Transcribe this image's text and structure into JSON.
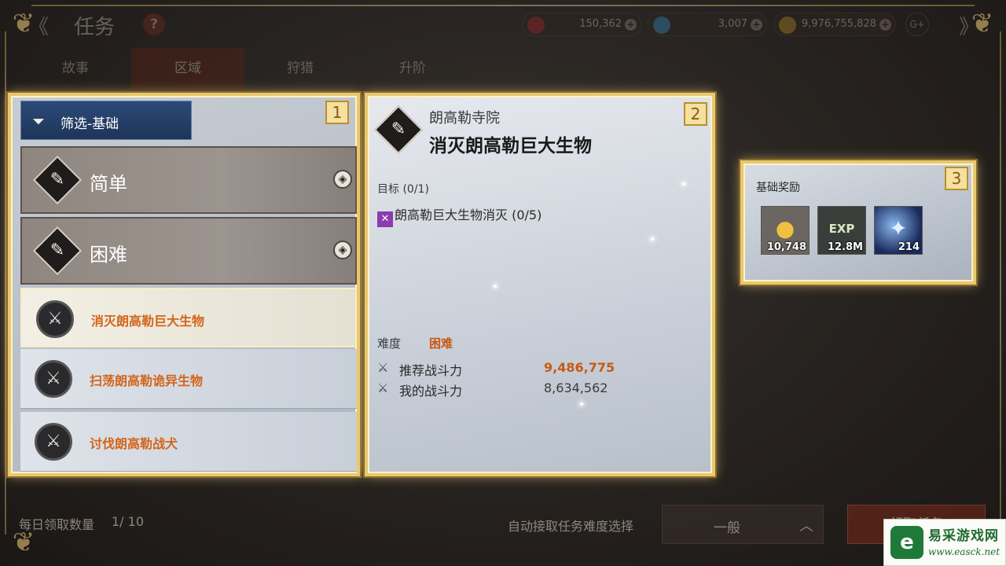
{
  "header": {
    "back_glyph": "《",
    "title": "任务",
    "help_glyph": "?",
    "currencies": [
      {
        "name": "red-gem",
        "value": "150,362",
        "color": "#c03030"
      },
      {
        "name": "blue-crystal",
        "value": "3,007",
        "color": "#3fa0d8"
      },
      {
        "name": "gold-coin",
        "value": "9,976,755,828",
        "color": "#d4a030"
      }
    ],
    "plus_glyph": "+",
    "extra_badge": "G+",
    "next_glyph": "》"
  },
  "tabs": [
    {
      "label": "故事",
      "active": false
    },
    {
      "label": "区域",
      "active": true
    },
    {
      "label": "狩猎",
      "active": false
    },
    {
      "label": "升阶",
      "active": false
    }
  ],
  "panel1": {
    "badge": "1",
    "filter_label": "筛选-基础",
    "categories": [
      {
        "label": "简单",
        "chevron": "◈"
      },
      {
        "label": "困难",
        "chevron": "◈"
      }
    ],
    "quests": [
      {
        "label": "消灭朗高勒巨大生物",
        "selected": true
      },
      {
        "label": "扫荡朗高勒诡异生物",
        "selected": false
      },
      {
        "label": "讨伐朗高勒战犬",
        "selected": false
      }
    ]
  },
  "panel2": {
    "badge": "2",
    "region": "朗高勒寺院",
    "title": "消灭朗高勒巨大生物",
    "goal_label": "目标 (0/1)",
    "goal_item": "朗高勒巨大生物消灭 (0/5)",
    "difficulty_label": "难度",
    "difficulty_value": "困难",
    "recommended_power_label": "推荐战斗力",
    "recommended_power_value": "9,486,775",
    "my_power_label": "我的战斗力",
    "my_power_value": "8,634,562"
  },
  "panel3": {
    "badge": "3",
    "title": "基础奖励",
    "rewards": [
      {
        "icon": "gold-coins-icon",
        "count": "10,748"
      },
      {
        "icon": "exp-icon",
        "glyph": "EXP",
        "count": "12.8M"
      },
      {
        "icon": "blue-orb-icon",
        "count": "214"
      }
    ]
  },
  "bottom": {
    "daily_label": "每日领取数量",
    "daily_value": "1/ 10",
    "auto_label": "自动接取任务难度选择",
    "auto_value": "一般",
    "accept_label": "领取任务"
  },
  "watermark": {
    "name": "易采游戏网",
    "url": "www.easck.net"
  },
  "colors": {
    "gold_frame": "#e8c870",
    "accent_orange": "#c85a14",
    "filter_blue": "#2c4a78"
  }
}
